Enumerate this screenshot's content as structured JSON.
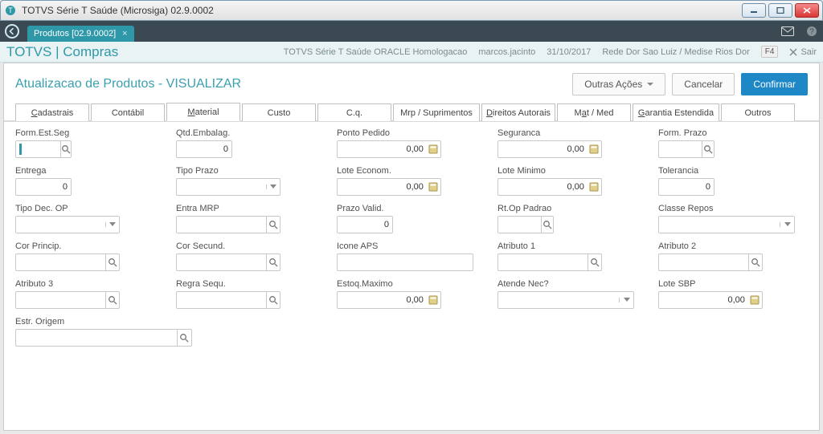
{
  "os": {
    "title": "TOTVS Série T Saúde (Microsiga) 02.9.0002"
  },
  "app_header": {
    "tab_label": "Produtos [02.9.0002]"
  },
  "module_bar": {
    "title": "TOTVS | Compras",
    "env": "TOTVS Série T Saúde ORACLE Homologacao",
    "user": "marcos.jacinto",
    "date": "31/10/2017",
    "org": "Rede Dor Sao Luiz / Medise Rios Dor",
    "f4": "F4",
    "sair": "Sair"
  },
  "panel": {
    "title": "Atualizacao de Produtos - VISUALIZAR",
    "actions": {
      "outras": "Outras Ações",
      "cancelar": "Cancelar",
      "confirmar": "Confirmar"
    }
  },
  "tabs": {
    "cadastrais": "Cadastrais",
    "contabil": "Contábil",
    "material": "Material",
    "custo": "Custo",
    "cq": "C.q.",
    "mrp": "Mrp / Suprimentos",
    "direitos": "Direitos Autorais",
    "matmed": "Mat / Med",
    "garantia": "Garantia Estendida",
    "outros": "Outros"
  },
  "fields": {
    "form_est_seg": {
      "label": "Form.Est.Seg",
      "value": ""
    },
    "qtd_embalag": {
      "label": "Qtd.Embalag.",
      "value": "0"
    },
    "ponto_pedido": {
      "label": "Ponto Pedido",
      "value": "0,00"
    },
    "seguranca": {
      "label": "Seguranca",
      "value": "0,00"
    },
    "form_prazo": {
      "label": "Form. Prazo",
      "value": ""
    },
    "entrega": {
      "label": "Entrega",
      "value": "0"
    },
    "tipo_prazo": {
      "label": "Tipo Prazo",
      "value": ""
    },
    "lote_econom": {
      "label": "Lote Econom.",
      "value": "0,00"
    },
    "lote_minimo": {
      "label": "Lote Minimo",
      "value": "0,00"
    },
    "tolerancia": {
      "label": "Tolerancia",
      "value": "0"
    },
    "tipo_dec_op": {
      "label": "Tipo Dec. OP",
      "value": ""
    },
    "entra_mrp": {
      "label": "Entra MRP",
      "value": ""
    },
    "prazo_valid": {
      "label": "Prazo Valid.",
      "value": "0"
    },
    "rt_op_padrao": {
      "label": "Rt.Op Padrao",
      "value": ""
    },
    "classe_repos": {
      "label": "Classe Repos",
      "value": ""
    },
    "cor_princip": {
      "label": "Cor Princip.",
      "value": ""
    },
    "cor_secund": {
      "label": "Cor Secund.",
      "value": ""
    },
    "icone_aps": {
      "label": "Icone APS",
      "value": ""
    },
    "atributo1": {
      "label": "Atributo 1",
      "value": ""
    },
    "atributo2": {
      "label": "Atributo 2",
      "value": ""
    },
    "atributo3": {
      "label": "Atributo 3",
      "value": ""
    },
    "regra_sequ": {
      "label": "Regra Sequ.",
      "value": ""
    },
    "estoq_maximo": {
      "label": "Estoq.Maximo",
      "value": "0,00"
    },
    "atende_nec": {
      "label": "Atende Nec?",
      "value": ""
    },
    "lote_sbp": {
      "label": "Lote SBP",
      "value": "0,00"
    },
    "estr_origem": {
      "label": "Estr. Origem",
      "value": ""
    }
  }
}
